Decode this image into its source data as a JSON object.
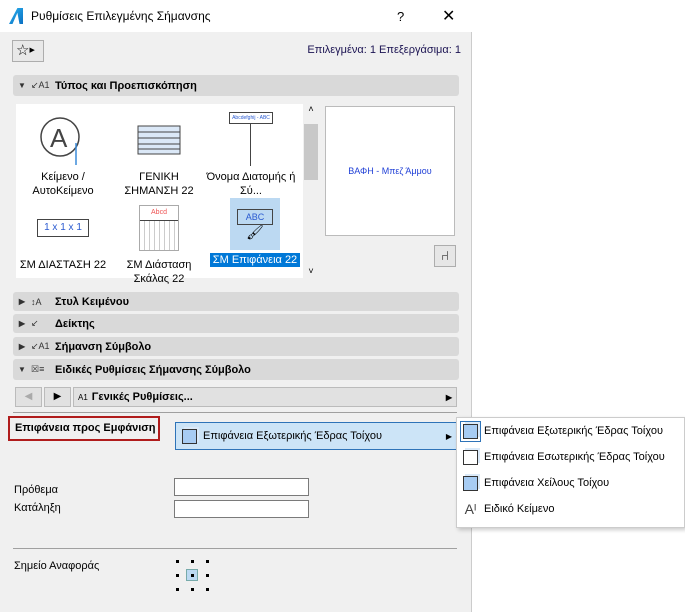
{
  "window": {
    "title": "Ρυθμίσεις Επιλεγμένης Σήμανσης",
    "help": "?",
    "close": "✕"
  },
  "header": {
    "favorites_icon": "star-icon",
    "selection_info": "Επιλεγμένα: 1 Επεξεργάσιμα: 1"
  },
  "sections": {
    "type_preview": "Τύπος και Προεπισκόπηση",
    "text_style": "Στυλ Κειμένου",
    "pointer": "Δείκτης",
    "marker_symbol": "Σήμανση Σύμβολο",
    "special_settings": "Ειδικές Ρυθμίσεις Σήμανσης Σύμβολο"
  },
  "gallery": {
    "items": [
      {
        "label": "Κείμενο / ΑυτοΚείμενο"
      },
      {
        "label": "ΓΕΝΙΚΗ ΣΗΜΑΝΣΗ 22"
      },
      {
        "label": "Όνομα Διατομής ή Σύ..."
      },
      {
        "label": "ΣΜ ΔΙΑΣΤΑΣΗ 22",
        "icon_text": "1 x 1 x 1"
      },
      {
        "label": "ΣΜ Διάσταση Σκάλας 22",
        "icon_text": "Abcd"
      },
      {
        "label": "ΣΜ Επιφάνεια 22",
        "icon_text": "ABC",
        "selected": true
      }
    ],
    "sign_text": "Abcdefghij - ABC"
  },
  "preview": {
    "text": "ΒΑΦΗ - Μπεζ Άμμου"
  },
  "nav": {
    "page": "Γενικές Ρυθμίσεις...",
    "page_icon": "A1"
  },
  "params": {
    "surface_label": "Επιφάνεια προς Εμφάνιση",
    "surface_value": "Επιφάνεια Εξωτερικής Έδρας Τοίχου",
    "prefix_label": "Πρόθεμα",
    "prefix_value": "",
    "suffix_label": "Κατάληξη",
    "suffix_value": "",
    "anchor_label": "Σημείο Αναφοράς"
  },
  "menu": {
    "items": [
      "Επιφάνεια Εξωτερικής Έδρας Τοίχου",
      "Επιφάνεια Εσωτερικής Έδρας Τοίχου",
      "Επιφάνεια Χείλους Τοίχου",
      "Ειδικό Κείμενο"
    ]
  },
  "colors": {
    "accent": "#0078d7",
    "highlight": "#cce4f7",
    "alert": "#b01c1c"
  }
}
